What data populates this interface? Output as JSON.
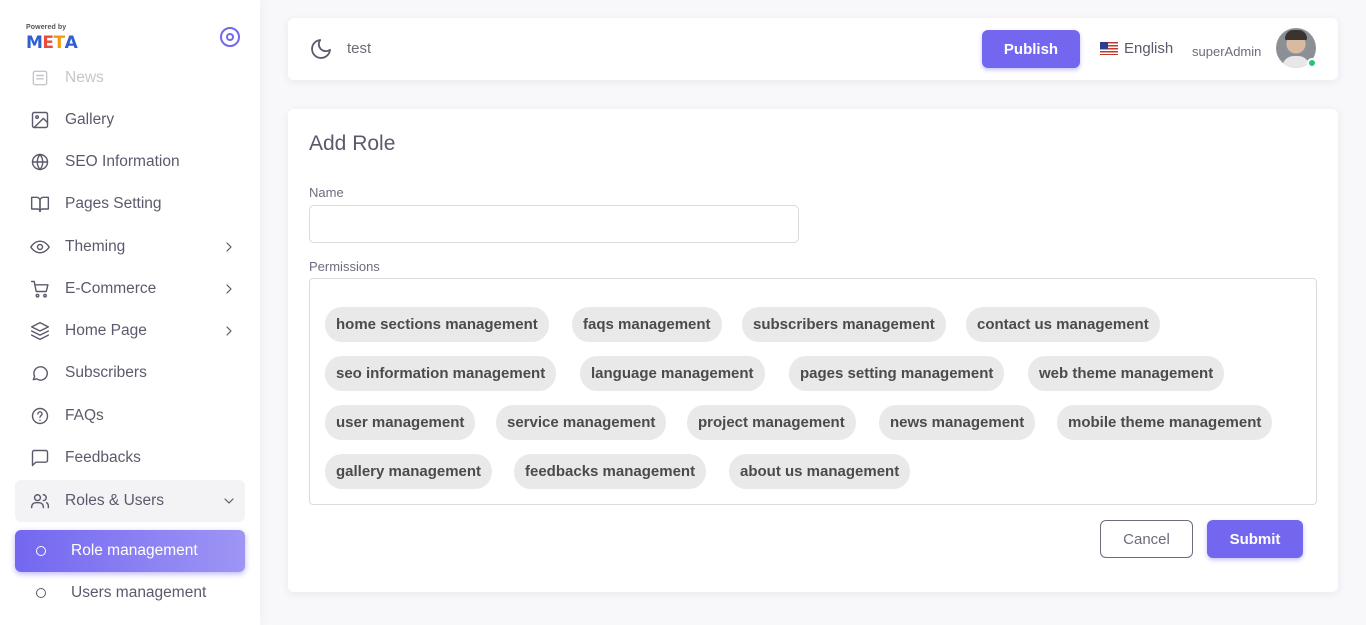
{
  "brand": {
    "powered_by": "Powered by",
    "logo_text": "META",
    "logo_colors": [
      "#2f5fd0",
      "#e74c3c",
      "#f39c12",
      "#2f5fd0"
    ]
  },
  "sidebar": {
    "items": [
      {
        "label": "News",
        "icon": "news-icon"
      },
      {
        "label": "Gallery",
        "icon": "image-icon"
      },
      {
        "label": "SEO Information",
        "icon": "globe-icon"
      },
      {
        "label": "Pages Setting",
        "icon": "book-icon"
      },
      {
        "label": "Theming",
        "icon": "eye-icon"
      },
      {
        "label": "E-Commerce",
        "icon": "cart-icon"
      },
      {
        "label": "Home Page",
        "icon": "layers-icon"
      },
      {
        "label": "Subscribers",
        "icon": "message-circle-icon"
      },
      {
        "label": "FAQs",
        "icon": "help-circle-icon"
      },
      {
        "label": "Feedbacks",
        "icon": "message-square-icon"
      },
      {
        "label": "Roles & Users",
        "icon": "users-icon"
      }
    ],
    "sub_items": [
      {
        "label": "Role management",
        "active": true
      },
      {
        "label": "Users management",
        "active": false
      }
    ]
  },
  "navbar": {
    "project": "test",
    "publish_label": "Publish",
    "language": "English",
    "user": "superAdmin",
    "status_color": "#28c76f"
  },
  "form": {
    "title": "Add Role",
    "name_label": "Name",
    "name_value": "",
    "permissions_label": "Permissions",
    "permissions": [
      "home sections management",
      "faqs management",
      "subscribers management",
      "contact us management",
      "seo information management",
      "language management",
      "pages setting management",
      "web theme management",
      "user management",
      "service management",
      "project management",
      "news management",
      "mobile theme management",
      "gallery management",
      "feedbacks management",
      "about us management"
    ],
    "cancel_label": "Cancel",
    "submit_label": "Submit"
  },
  "colors": {
    "accent": "#7367f0",
    "text": "#5d596c",
    "chip_bg": "#e9e9ea"
  }
}
